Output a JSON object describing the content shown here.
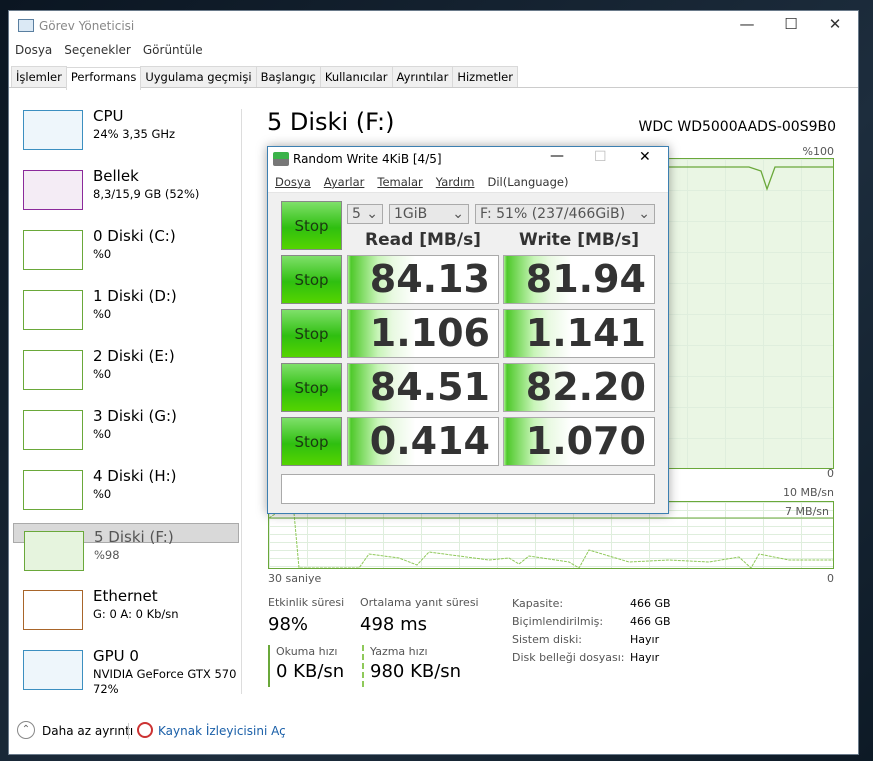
{
  "window": {
    "title": "Görev Yöneticisi",
    "menu": [
      "Dosya",
      "Seçenekler",
      "Görüntüle"
    ],
    "tabs": [
      "İşlemler",
      "Performans",
      "Uygulama geçmişi",
      "Başlangıç",
      "Kullanıcılar",
      "Ayrıntılar",
      "Hizmetler"
    ],
    "active_tab": "Performans"
  },
  "sidebar": [
    {
      "name": "CPU",
      "sub": "24%  3,35 GHz",
      "color": "#3c8fc0"
    },
    {
      "name": "Bellek",
      "sub": "8,3/15,9 GB (52%)",
      "color": "#8b2a9b"
    },
    {
      "name": "0 Diski (C:)",
      "sub": "%0",
      "color": "#6aa83a"
    },
    {
      "name": "1 Diski (D:)",
      "sub": "%0",
      "color": "#6aa83a"
    },
    {
      "name": "2 Diski (E:)",
      "sub": "%0",
      "color": "#6aa83a"
    },
    {
      "name": "3 Diski (G:)",
      "sub": "%0",
      "color": "#6aa83a"
    },
    {
      "name": "4 Diski (H:)",
      "sub": "%0",
      "color": "#6aa83a"
    },
    {
      "name": "5 Diski (F:)",
      "sub": "%98",
      "color": "#6aa83a",
      "selected": true
    },
    {
      "name": "Ethernet",
      "sub": "G: 0 A: 0 Kb/sn",
      "color": "#a8652a"
    },
    {
      "name": "GPU 0",
      "sub": "NVIDIA GeForce GTX 570",
      "sub2": "72%",
      "color": "#3c8fc0"
    }
  ],
  "main": {
    "title": "5 Diski (F:)",
    "model": "WDC WD5000AADS-00S9B0",
    "chart1_max": "%100",
    "chart1_min": "0",
    "chart2_max": "10 MB/sn",
    "chart2_mark": "7 MB/sn",
    "time_left": "30 saniye",
    "time_right": "0",
    "stats": {
      "active_label": "Etkinlik süresi",
      "active": "98%",
      "resp_label": "Ortalama yanıt süresi",
      "resp": "498 ms",
      "read_label": "Okuma hızı",
      "read": "0 KB/sn",
      "write_label": "Yazma hızı",
      "write": "980 KB/sn"
    },
    "props": [
      [
        "Kapasite:",
        "466 GB"
      ],
      [
        "Biçimlendirilmiş:",
        "466 GB"
      ],
      [
        "Sistem diski:",
        "Hayır"
      ],
      [
        "Disk belleği dosyası:",
        "Hayır"
      ]
    ]
  },
  "footer": {
    "less": "Daha az ayrıntı",
    "monitor": "Kaynak İzleyicisini Aç"
  },
  "cdm": {
    "title": "Random Write 4KiB [4/5]",
    "menu": [
      "Dosya",
      "Ayarlar",
      "Temalar",
      "Yardım",
      "Dil(Language)"
    ],
    "count": "5",
    "size": "1GiB",
    "drive": "F: 51% (237/466GiB)",
    "read_hdr": "Read [MB/s]",
    "write_hdr": "Write [MB/s]",
    "stop": "Stop",
    "rows": [
      {
        "read": "84.13",
        "write": "81.94"
      },
      {
        "read": "1.106",
        "write": "1.141"
      },
      {
        "read": "84.51",
        "write": "82.20"
      },
      {
        "read": "0.414",
        "write": "1.070"
      }
    ],
    "comment": ""
  }
}
